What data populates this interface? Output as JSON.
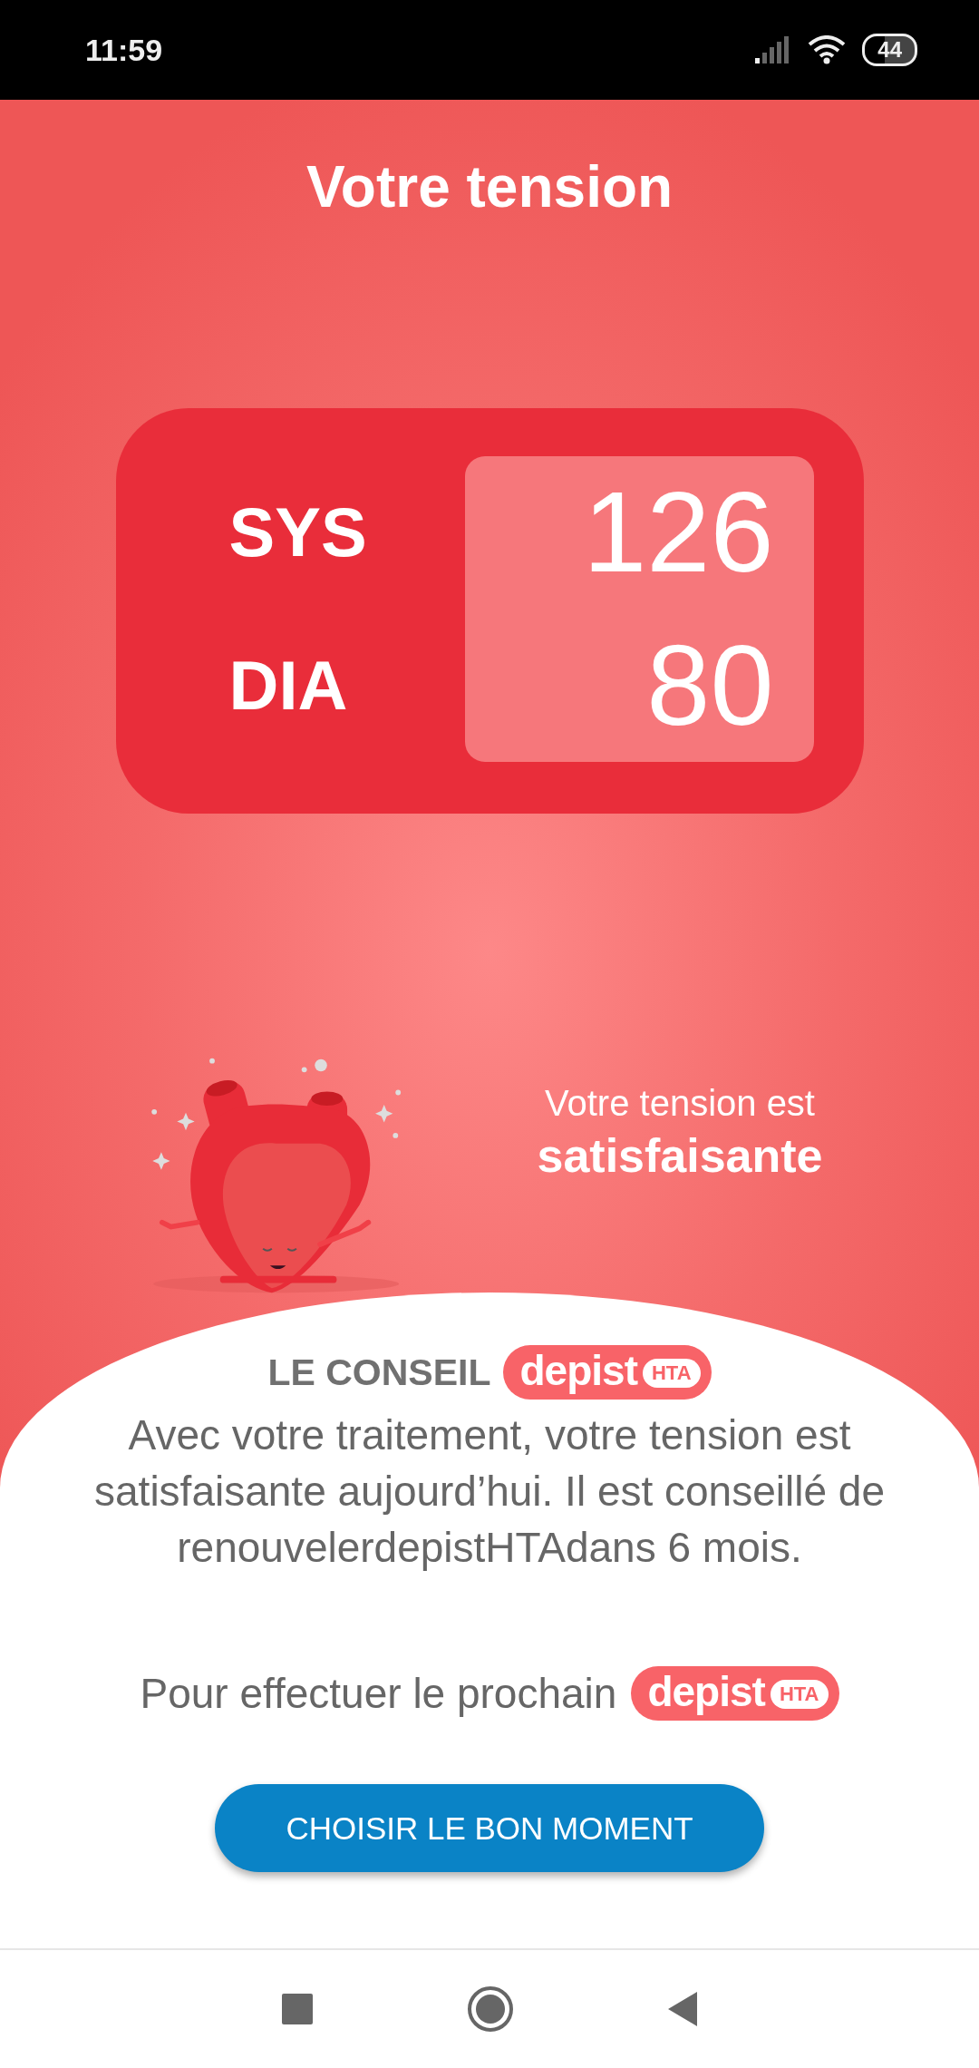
{
  "status_bar": {
    "time": "11:59",
    "battery": "44"
  },
  "title": "Votre tension",
  "readings": [
    {
      "label": "SYS",
      "value": "126"
    },
    {
      "label": "DIA",
      "value": "80"
    }
  ],
  "verdict": {
    "intro": "Votre tension est",
    "result": "satisfaisante"
  },
  "advice": {
    "heading": "LE CONSEIL",
    "badge": {
      "word": "depist",
      "tag": "HTA"
    },
    "text": "Avec votre traitement, votre tension est satisfaisante aujourd’hui. Il est conseillé de renouvelerdepistHTAdans 6 mois."
  },
  "next": {
    "text": "Pour effectuer le prochain",
    "badge": {
      "word": "depist",
      "tag": "HTA"
    }
  },
  "button": "CHOISIR LE BON MOMENT"
}
